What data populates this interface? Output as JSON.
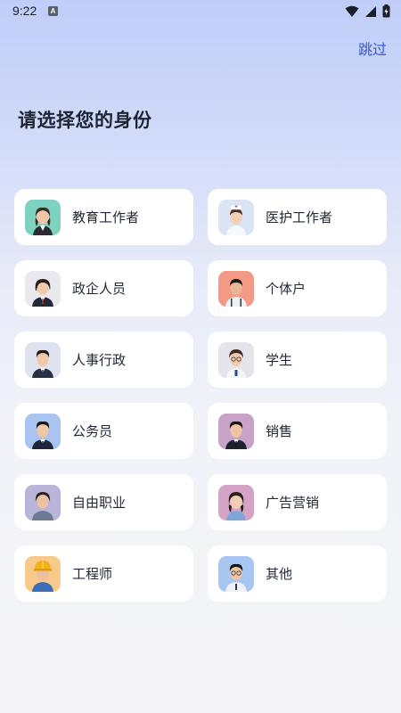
{
  "status_bar": {
    "time": "9:22",
    "badge": "A"
  },
  "header": {
    "skip_label": "跳过",
    "title": "请选择您的身份"
  },
  "identities": [
    {
      "label": "教育工作者",
      "avatar_bg": "#7dd3c0",
      "avatar": "teacher-avatar"
    },
    {
      "label": "医护工作者",
      "avatar_bg": "#dbe4f5",
      "avatar": "nurse-avatar"
    },
    {
      "label": "政企人员",
      "avatar_bg": "#e8e8ee",
      "avatar": "official-avatar"
    },
    {
      "label": "个体户",
      "avatar_bg": "#f39a86",
      "avatar": "self-employed-avatar"
    },
    {
      "label": "人事行政",
      "avatar_bg": "#dfe3ef",
      "avatar": "hr-avatar"
    },
    {
      "label": "学生",
      "avatar_bg": "#e4e4ea",
      "avatar": "student-avatar"
    },
    {
      "label": "公务员",
      "avatar_bg": "#a9c4f0",
      "avatar": "civil-servant-avatar"
    },
    {
      "label": "销售",
      "avatar_bg": "#c9a3c7",
      "avatar": "sales-avatar"
    },
    {
      "label": "自由职业",
      "avatar_bg": "#b9b5d8",
      "avatar": "freelancer-avatar"
    },
    {
      "label": "广告营销",
      "avatar_bg": "#d4a3c6",
      "avatar": "marketing-avatar"
    },
    {
      "label": "工程师",
      "avatar_bg": "#f7c98a",
      "avatar": "engineer-avatar"
    },
    {
      "label": "其他",
      "avatar_bg": "#a8c6f2",
      "avatar": "other-avatar"
    }
  ],
  "colors": {
    "accent": "#2f5bd9",
    "card": "#ffffff"
  }
}
